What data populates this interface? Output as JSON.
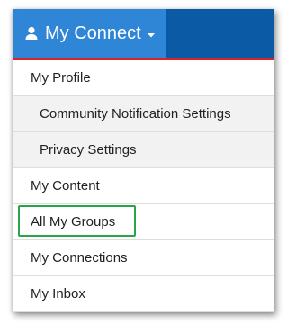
{
  "menu": {
    "trigger_label": "My Connect",
    "trigger_icon": "user-icon",
    "caret_icon": "caret-down-icon",
    "items": [
      {
        "label": "My Profile",
        "level": 0
      },
      {
        "label": "Community Notification Settings",
        "level": 1
      },
      {
        "label": "Privacy Settings",
        "level": 1
      },
      {
        "label": "My Content",
        "level": 0
      },
      {
        "label": "All My Groups",
        "level": 0,
        "highlighted": true
      },
      {
        "label": "My Connections",
        "level": 0
      },
      {
        "label": "My Inbox",
        "level": 0
      }
    ]
  },
  "colors": {
    "trigger_bg": "#2f86d6",
    "header_bg": "#0b5aa6",
    "accent_line": "#d8232a",
    "highlight_outline": "#2aa44a",
    "submenu_bg": "#f2f2f2"
  }
}
